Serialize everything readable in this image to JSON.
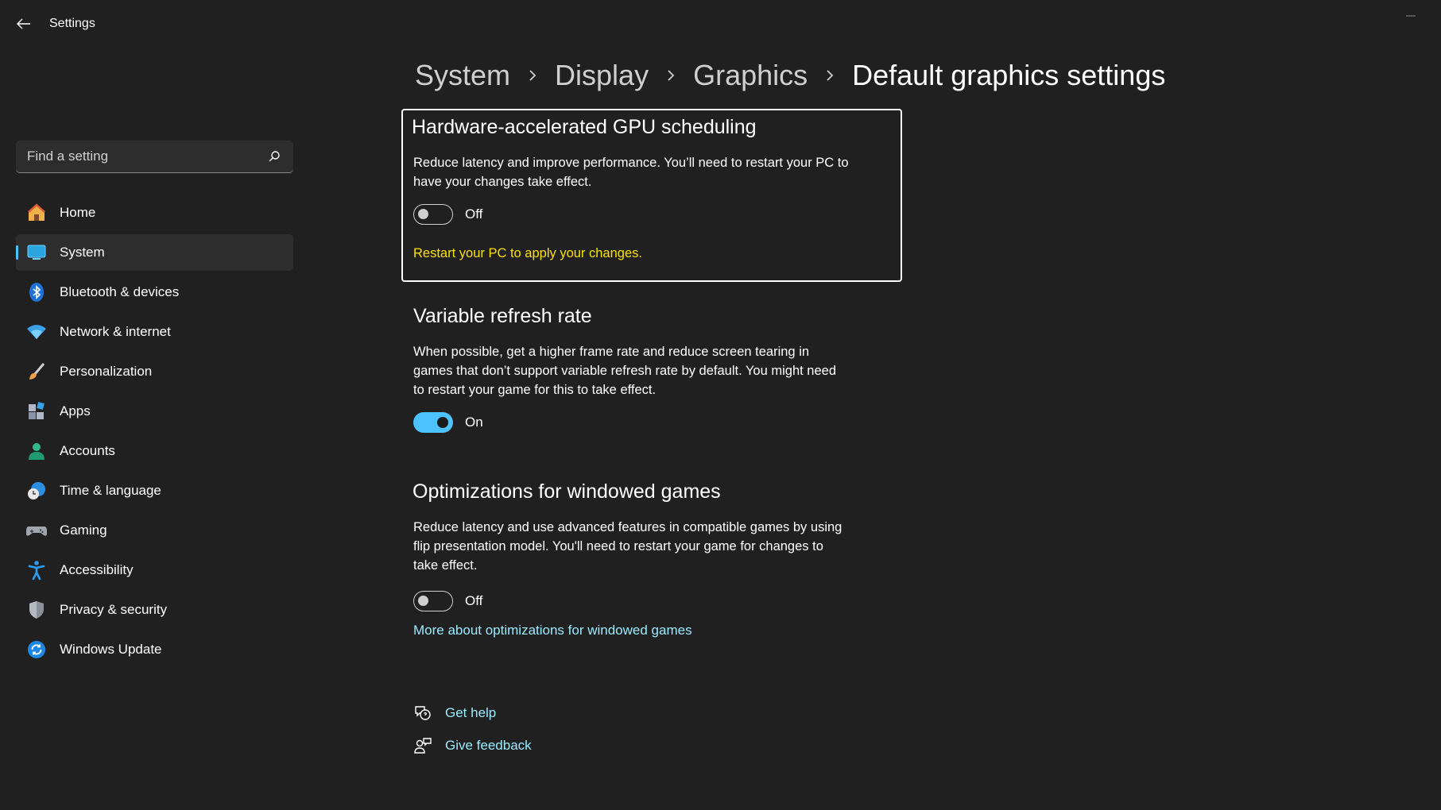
{
  "window": {
    "title": "Settings"
  },
  "search": {
    "placeholder": "Find a setting"
  },
  "sidebar": {
    "items": [
      {
        "label": "Home",
        "icon": "home-icon"
      },
      {
        "label": "System",
        "icon": "system-icon",
        "active": true
      },
      {
        "label": "Bluetooth & devices",
        "icon": "bluetooth-icon"
      },
      {
        "label": "Network & internet",
        "icon": "wifi-icon"
      },
      {
        "label": "Personalization",
        "icon": "brush-icon"
      },
      {
        "label": "Apps",
        "icon": "apps-icon"
      },
      {
        "label": "Accounts",
        "icon": "accounts-icon"
      },
      {
        "label": "Time & language",
        "icon": "clock-globe-icon"
      },
      {
        "label": "Gaming",
        "icon": "gamepad-icon"
      },
      {
        "label": "Accessibility",
        "icon": "accessibility-icon"
      },
      {
        "label": "Privacy & security",
        "icon": "shield-icon"
      },
      {
        "label": "Windows Update",
        "icon": "update-icon"
      }
    ]
  },
  "breadcrumb": [
    "System",
    "Display",
    "Graphics",
    "Default graphics settings"
  ],
  "sections": {
    "gpu": {
      "title": "Hardware-accelerated GPU scheduling",
      "desc": "Reduce latency and improve performance. You’ll need to restart your PC to have your changes take effect.",
      "state": "Off",
      "warning": "Restart your PC to apply your changes."
    },
    "vrr": {
      "title": "Variable refresh rate",
      "desc": "When possible, get a higher frame rate and reduce screen tearing in games that don’t support variable refresh rate by default. You might need to restart your game for this to take effect.",
      "state": "On"
    },
    "windowed": {
      "title": "Optimizations for windowed games",
      "desc": "Reduce latency and use advanced features in compatible games by using flip presentation model. You'll need to restart your game for changes to take effect.",
      "state": "Off",
      "link": "More about optimizations for windowed games"
    }
  },
  "help": {
    "get_help": "Get help",
    "give_feedback": "Give feedback"
  },
  "colors": {
    "background": "#202020",
    "accent": "#4cc2ff",
    "link": "#99ebff",
    "warning": "#fce100"
  }
}
